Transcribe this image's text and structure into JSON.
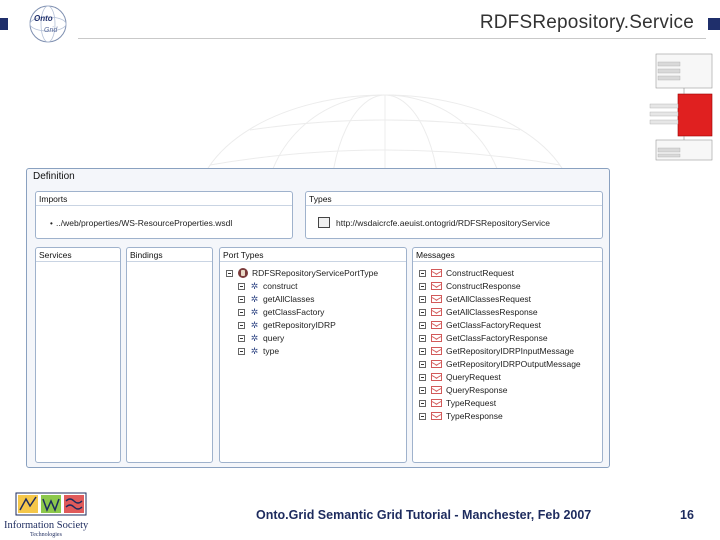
{
  "header": {
    "title": "RDFSRepository.Service",
    "logo_text": "OntoGrid"
  },
  "definition": {
    "title": "Definition",
    "imports": {
      "title": "Imports",
      "path": "../web/properties/WS-ResourceProperties.wsdl"
    },
    "types": {
      "title": "Types",
      "url": "http://wsdaicrcfe.aeuist.ontogrid/RDFSRepositoryService"
    },
    "services": {
      "title": "Services"
    },
    "bindings": {
      "title": "Bindings"
    },
    "port_types": {
      "title": "Port Types",
      "root": "RDFSRepositoryServicePortType",
      "operations": [
        "construct",
        "getAllClasses",
        "getClassFactory",
        "getRepositoryIDRP",
        "query",
        "type"
      ]
    },
    "messages": {
      "title": "Messages",
      "items": [
        "ConstructRequest",
        "ConstructResponse",
        "GetAllClassesRequest",
        "GetAllClassesResponse",
        "GetClassFactoryRequest",
        "GetClassFactoryResponse",
        "GetRepositoryIDRPInputMessage",
        "GetRepositoryIDRPOutputMessage",
        "QueryRequest",
        "QueryResponse",
        "TypeRequest",
        "TypeResponse"
      ]
    }
  },
  "footer": {
    "org_label": "Information Society",
    "org_sub": "Technologies",
    "text": "Onto.Grid Semantic Grid Tutorial - Manchester, Feb 2007",
    "page_number": "16"
  },
  "colors": {
    "accent_navy": "#1f2f6b",
    "panel_border": "#8aa1c0",
    "mini_highlight": "#e02020"
  }
}
